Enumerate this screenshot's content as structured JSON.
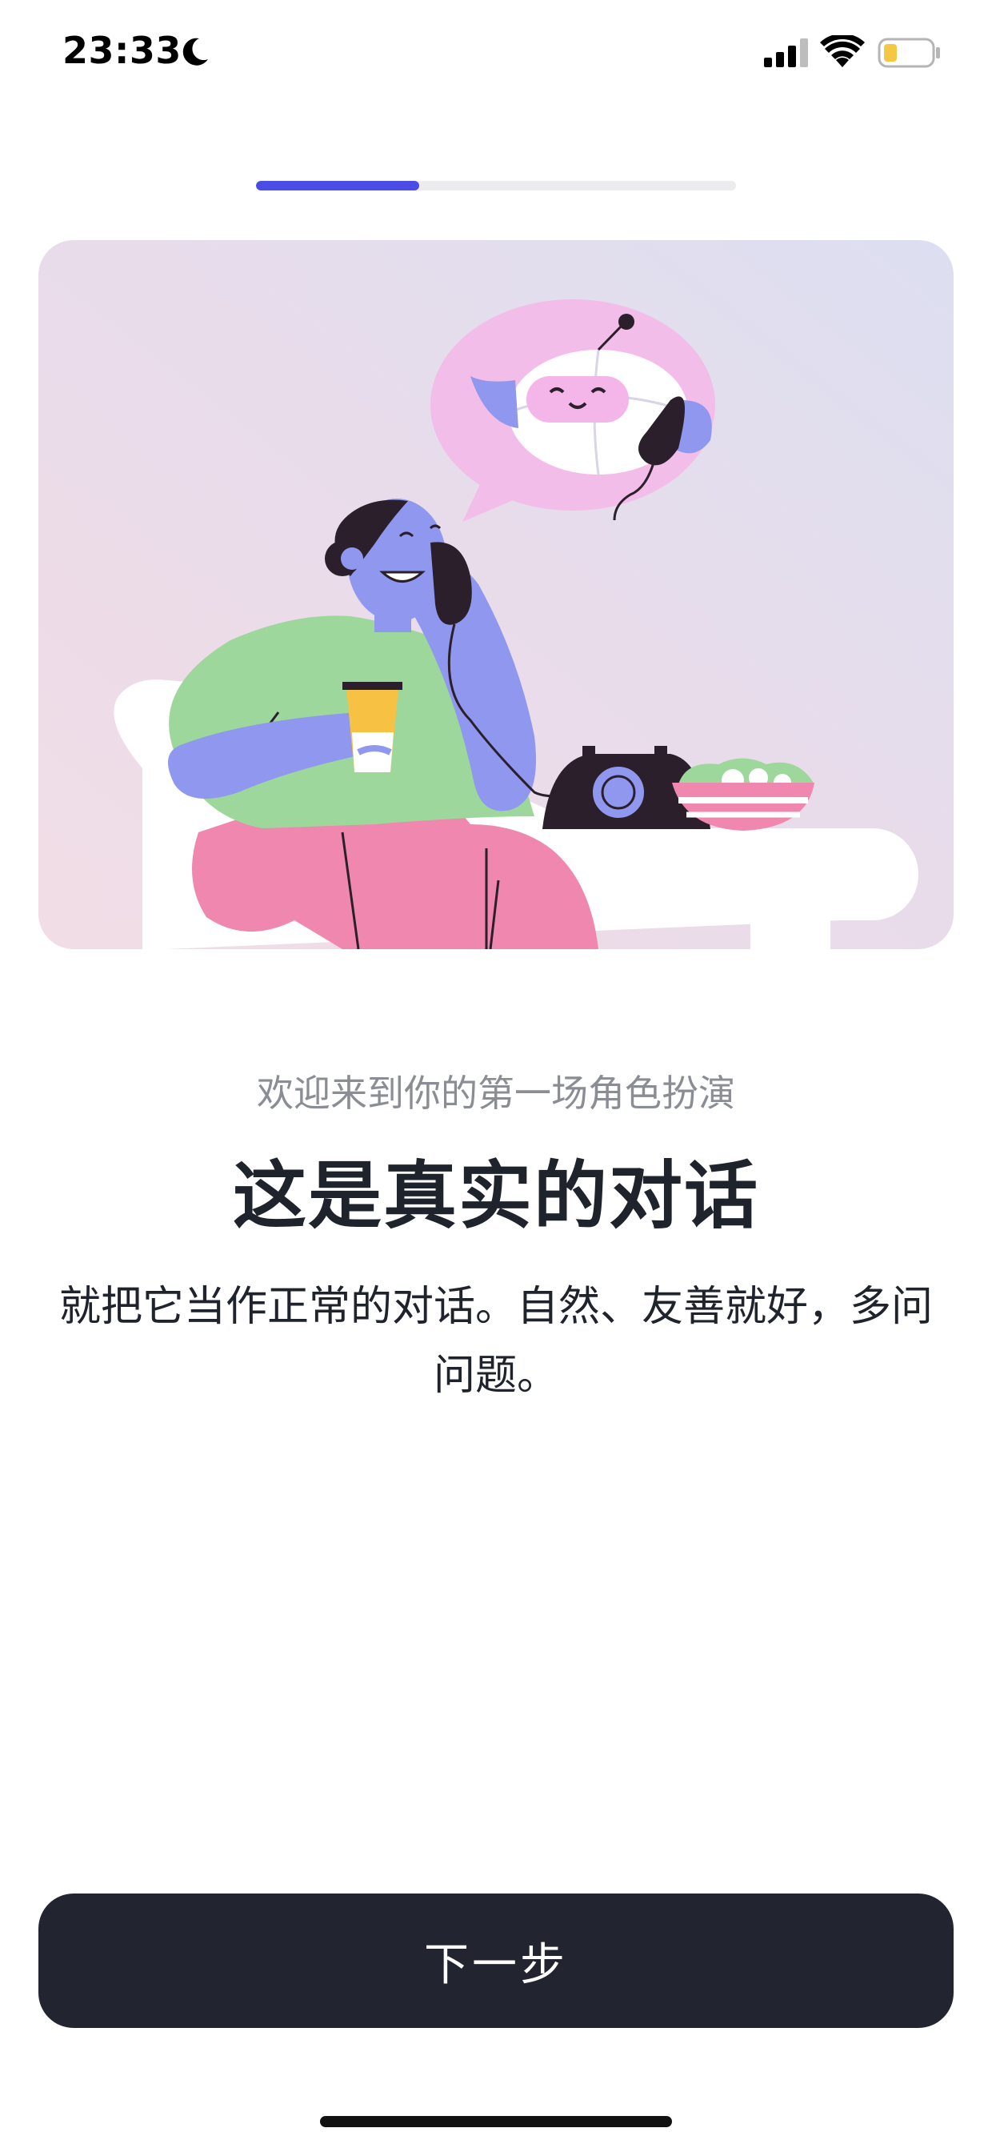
{
  "status_bar": {
    "time": "23:33",
    "icons": [
      "moon-icon",
      "signal-icon",
      "wifi-icon",
      "battery-icon"
    ],
    "battery_color": "#f4c844"
  },
  "progress": {
    "value": 0.34,
    "fill_color": "#4b4ce6",
    "track_color": "#ececef"
  },
  "illustration": {
    "description_icon": "illustration-woman-on-phone-with-robot"
  },
  "content": {
    "subtitle": "欢迎来到你的第一场角色扮演",
    "title": "这是真实的对话",
    "description": "就把它当作正常的对话。自然、友善就好，多问问题。"
  },
  "next_button": {
    "label": "下一步",
    "color": "#22252f"
  }
}
